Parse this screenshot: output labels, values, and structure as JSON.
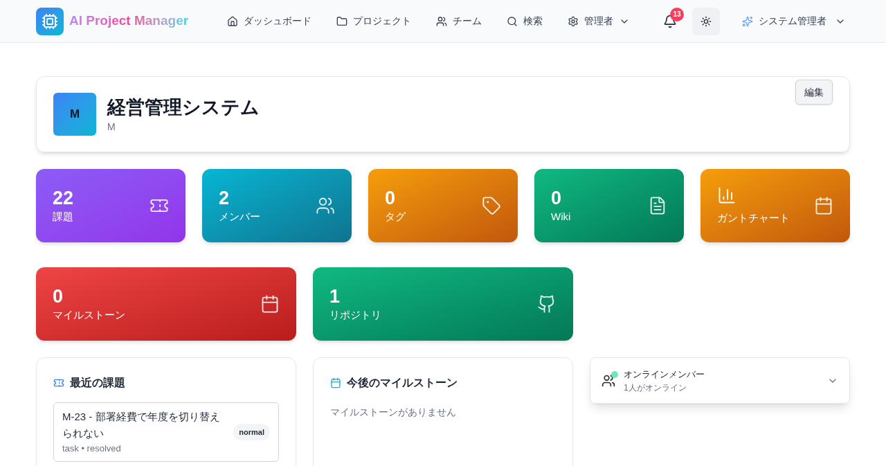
{
  "header": {
    "logo_text": "AI Project Manager",
    "nav": [
      {
        "label": "ダッシュボード",
        "dropdown": false
      },
      {
        "label": "プロジェクト",
        "dropdown": false
      },
      {
        "label": "チーム",
        "dropdown": false
      },
      {
        "label": "検索",
        "dropdown": false
      },
      {
        "label": "管理者",
        "dropdown": true
      }
    ],
    "notifications": "13",
    "user": "システム管理者"
  },
  "project": {
    "avatar": "M",
    "title": "経営管理システム",
    "key": "M",
    "edit_button": "編集"
  },
  "stats": [
    {
      "value": "22",
      "label": "課題"
    },
    {
      "value": "2",
      "label": "メンバー"
    },
    {
      "value": "0",
      "label": "タグ"
    },
    {
      "value": "0",
      "label": "Wiki"
    },
    {
      "label": "ガントチャート"
    },
    {
      "value": "0",
      "label": "マイルストーン"
    },
    {
      "value": "1",
      "label": "リポジトリ"
    }
  ],
  "recent_issues": {
    "title": "最近の課題",
    "items": [
      {
        "title": "M-23 - 部署経費で年度を切り替えられない",
        "priority": "normal",
        "meta": "task • resolved"
      }
    ]
  },
  "milestones": {
    "title": "今後のマイルストーン",
    "empty": "マイルストーンがありません"
  },
  "online": {
    "title": "オンラインメンバー",
    "subtitle": "1人がオンライン"
  }
}
